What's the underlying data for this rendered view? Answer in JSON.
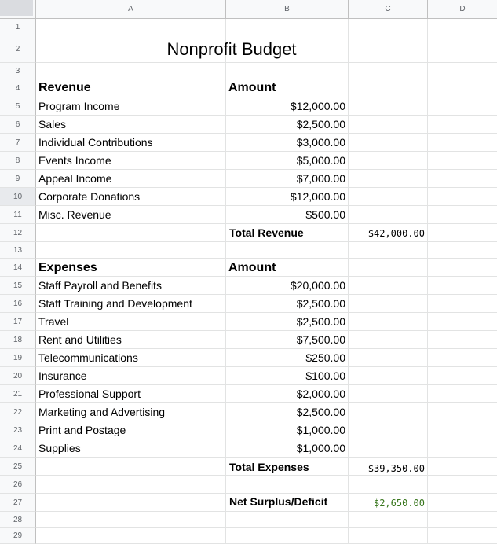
{
  "columns": [
    "A",
    "B",
    "C",
    "D"
  ],
  "rows": [
    "1",
    "2",
    "3",
    "4",
    "5",
    "6",
    "7",
    "8",
    "9",
    "10",
    "11",
    "12",
    "13",
    "14",
    "15",
    "16",
    "17",
    "18",
    "19",
    "20",
    "21",
    "22",
    "23",
    "24",
    "25",
    "26",
    "27",
    "28",
    "29"
  ],
  "title": "Nonprofit Budget",
  "revenue": {
    "header": "Revenue",
    "amount_header": "Amount",
    "items": [
      {
        "label": "Program Income",
        "amount": "$12,000.00"
      },
      {
        "label": "Sales",
        "amount": "$2,500.00"
      },
      {
        "label": "Individual Contributions",
        "amount": "$3,000.00"
      },
      {
        "label": "Events Income",
        "amount": "$5,000.00"
      },
      {
        "label": "Appeal Income",
        "amount": "$7,000.00"
      },
      {
        "label": "Corporate Donations",
        "amount": "$12,000.00"
      },
      {
        "label": "Misc. Revenue",
        "amount": "$500.00"
      }
    ],
    "total_label": "Total Revenue",
    "total_value": "$42,000.00"
  },
  "expenses": {
    "header": "Expenses",
    "amount_header": "Amount",
    "items": [
      {
        "label": "Staff Payroll and Benefits",
        "amount": "$20,000.00"
      },
      {
        "label": "Staff Training and Development",
        "amount": "$2,500.00"
      },
      {
        "label": "Travel",
        "amount": "$2,500.00"
      },
      {
        "label": "Rent and Utilities",
        "amount": "$7,500.00"
      },
      {
        "label": "Telecommunications",
        "amount": "$250.00"
      },
      {
        "label": "Insurance",
        "amount": "$100.00"
      },
      {
        "label": "Professional Support",
        "amount": "$2,000.00"
      },
      {
        "label": "Marketing and Advertising",
        "amount": "$2,500.00"
      },
      {
        "label": "Print and Postage",
        "amount": "$1,000.00"
      },
      {
        "label": "Supplies",
        "amount": "$1,000.00"
      }
    ],
    "total_label": "Total Expenses",
    "total_value": "$39,350.00"
  },
  "net": {
    "label": "Net Surplus/Deficit",
    "value": "$2,650.00"
  },
  "selected_row": "10"
}
